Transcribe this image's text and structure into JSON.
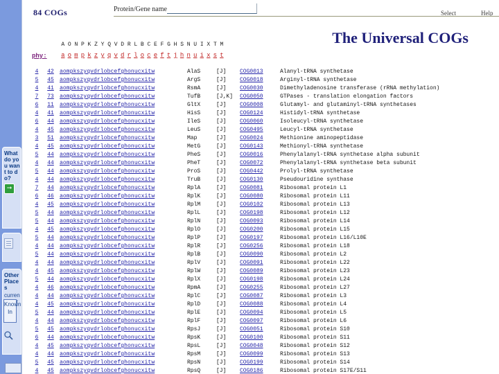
{
  "explorer_pane": {
    "card_a_title": "What do you want to do?",
    "card_a_icon": "arrow-right-icon",
    "card_b_icon": "document-icon",
    "card_c_title": "Other Places",
    "card_c_text": "current search",
    "card_c_button": "Known In",
    "search_icon": "magnifier-icon"
  },
  "toolbar": {
    "cog_count": "84 COGs",
    "search_label": "Protein/Gene name:",
    "search_value": "",
    "search_placeholder": "",
    "select_label": "Select",
    "help_label": "Help"
  },
  "title": "The Universal COGs",
  "phylogeny": {
    "label": "phy:",
    "upper": [
      "A",
      "O",
      "N",
      "P",
      "K",
      "Z",
      "Y",
      "Q",
      "V",
      "D",
      "R",
      "L",
      "B",
      "C",
      "E",
      "F",
      "G",
      "H",
      "S",
      "N",
      "U",
      "I",
      "X",
      "T",
      "M"
    ],
    "lower": [
      "a",
      "o",
      "m",
      "p",
      "k",
      "z",
      "y",
      "q",
      "v",
      "d",
      "r",
      "l",
      "o",
      "c",
      "e",
      "f",
      "t",
      "j",
      "h",
      "n",
      "u",
      "i",
      "x",
      "s",
      "t"
    ]
  },
  "table": {
    "rows": [
      {
        "n1": "4",
        "n2": "42",
        "pattern": "aompkszyqvdrlobcefghonucxitw",
        "gene": "AlaS",
        "func": "[J]",
        "cog": "COG0013",
        "desc": "Alanyl-tRNA synthetase"
      },
      {
        "n1": "5",
        "n2": "45",
        "pattern": "aompkszyqvdrlobcefghonucxitw",
        "gene": "ArgS",
        "func": "[J]",
        "cog": "COG0018",
        "desc": "Arginyl-tRNA synthetase"
      },
      {
        "n1": "4",
        "n2": "41",
        "pattern": "aompkszyqvdrlobcefghonucxitw",
        "gene": "RsmA",
        "func": "[J]",
        "cog": "COG0030",
        "desc": "Dimethyladenosine transferase (rRNA methylation)"
      },
      {
        "n1": "7",
        "n2": "73",
        "pattern": "aompkszyqvdrlobcefghonucxitw",
        "gene": "TufB",
        "func": "[J,K]",
        "cog": "COG0050",
        "desc": "GTPases - translation elongation factors"
      },
      {
        "n1": "6",
        "n2": "11",
        "pattern": "aompkszyqvdrlobcefghonucxitw",
        "gene": "GltX",
        "func": "[J]",
        "cog": "COG0008",
        "desc": "Glutamyl- and glutaminyl-tRNA synthetases"
      },
      {
        "n1": "4",
        "n2": "41",
        "pattern": "aompkszyqvdrlobcefghonucxitw",
        "gene": "HisS",
        "func": "[J]",
        "cog": "COG0124",
        "desc": "Histidyl-tRNA synthetase"
      },
      {
        "n1": "6",
        "n2": "44",
        "pattern": "aompkszyqvdrlobcefghonucxitw",
        "gene": "IleS",
        "func": "[J]",
        "cog": "COG0060",
        "desc": "Isoleucyl-tRNA synthetase"
      },
      {
        "n1": "4",
        "n2": "45",
        "pattern": "aompkszyqvdrlobcefghonucxitw",
        "gene": "LeuS",
        "func": "[J]",
        "cog": "COG0495",
        "desc": "Leucyl-tRNA synthetase"
      },
      {
        "n1": "3",
        "n2": "51",
        "pattern": "aompkszyqvdrlobcefghonucxitw",
        "gene": "Map",
        "func": "[J]",
        "cog": "COG0024",
        "desc": "Methionine aminopeptidase"
      },
      {
        "n1": "4",
        "n2": "45",
        "pattern": "aompkszyqvdrlobcefghonucxitw",
        "gene": "MetG",
        "func": "[J]",
        "cog": "COG0143",
        "desc": "Methionyl-tRNA synthetase"
      },
      {
        "n1": "5",
        "n2": "44",
        "pattern": "aompkszyqvdrlobcefghonucxitw",
        "gene": "PheS",
        "func": "[J]",
        "cog": "COG0016",
        "desc": "Phenylalanyl-tRNA synthetase alpha subunit"
      },
      {
        "n1": "4",
        "n2": "44",
        "pattern": "aompkszyqvdrlobcefghonucxitw",
        "gene": "PheT",
        "func": "[J]",
        "cog": "COG0072",
        "desc": "Phenylalanyl-tRNA synthetase beta subunit"
      },
      {
        "n1": "5",
        "n2": "44",
        "pattern": "aompkszyqvdrlobcefghonucxitw",
        "gene": "ProS",
        "func": "[J]",
        "cog": "COG0442",
        "desc": "Prolyl-tRNA synthetase"
      },
      {
        "n1": "4",
        "n2": "44",
        "pattern": "aompkszyqvdrlobcefghonucxitw",
        "gene": "TruB",
        "func": "[J]",
        "cog": "COG0130",
        "desc": "Pseudouridine synthase"
      },
      {
        "n1": "7",
        "n2": "44",
        "pattern": "aompkszyqvdrlobcefghonucxitw",
        "gene": "RplA",
        "func": "[J]",
        "cog": "COG0081",
        "desc": "Ribosomal protein L1"
      },
      {
        "n1": "6",
        "n2": "46",
        "pattern": "aompkszyqvdrlobcefghonucxitw",
        "gene": "RplK",
        "func": "[J]",
        "cog": "COG0080",
        "desc": "Ribosomal protein L11"
      },
      {
        "n1": "4",
        "n2": "45",
        "pattern": "aompkszyqvdrlobcefghonucxitw",
        "gene": "RplM",
        "func": "[J]",
        "cog": "COG0102",
        "desc": "Ribosomal protein L13"
      },
      {
        "n1": "5",
        "n2": "44",
        "pattern": "aompkszyqvdrlobcefghonucxitw",
        "gene": "RplL",
        "func": "[J]",
        "cog": "COG0198",
        "desc": "Ribosomal protein L12"
      },
      {
        "n1": "5",
        "n2": "44",
        "pattern": "aompkszyqvdrlobcefghonucxitw",
        "gene": "RplN",
        "func": "[J]",
        "cog": "COG0093",
        "desc": "Ribosomal protein L14"
      },
      {
        "n1": "4",
        "n2": "45",
        "pattern": "aompkszyqvdrlobcefghonucxitw",
        "gene": "RplO",
        "func": "[J]",
        "cog": "COG0200",
        "desc": "Ribosomal protein L15"
      },
      {
        "n1": "5",
        "n2": "44",
        "pattern": "aompkszyqvdrlobcefghonucxitw",
        "gene": "RplP",
        "func": "[J]",
        "cog": "COG0197",
        "desc": "Ribosomal protein L16/L10E"
      },
      {
        "n1": "4",
        "n2": "44",
        "pattern": "aompkszyqvdrlobcefghonucxitw",
        "gene": "RplR",
        "func": "[J]",
        "cog": "COG0256",
        "desc": "Ribosomal protein L18"
      },
      {
        "n1": "5",
        "n2": "44",
        "pattern": "aompkszyqvdrlobcefghonucxitw",
        "gene": "RplB",
        "func": "[J]",
        "cog": "COG0090",
        "desc": "Ribosomal protein L2"
      },
      {
        "n1": "4",
        "n2": "44",
        "pattern": "aompkszyqvdrlobcefghonucxitw",
        "gene": "RplV",
        "func": "[J]",
        "cog": "COG0091",
        "desc": "Ribosomal protein L22"
      },
      {
        "n1": "4",
        "n2": "45",
        "pattern": "aompkszyqvdrlobcefghonucxitw",
        "gene": "RplW",
        "func": "[J]",
        "cog": "COG0089",
        "desc": "Ribosomal protein L23"
      },
      {
        "n1": "5",
        "n2": "44",
        "pattern": "aompkszyqvdrlobcefghonucxitw",
        "gene": "RplX",
        "func": "[J]",
        "cog": "COG0198",
        "desc": "Ribosomal protein L24"
      },
      {
        "n1": "4",
        "n2": "46",
        "pattern": "aompkszyqvdrlobcefghonucxitw",
        "gene": "RpmA",
        "func": "[J]",
        "cog": "COG0255",
        "desc": "Ribosomal protein L27"
      },
      {
        "n1": "4",
        "n2": "44",
        "pattern": "aompkszyqvdrlobcefghonucxitw",
        "gene": "RplC",
        "func": "[J]",
        "cog": "COG0087",
        "desc": "Ribosomal protein L3"
      },
      {
        "n1": "4",
        "n2": "45",
        "pattern": "aompkszyqvdrlobcefghonucxitw",
        "gene": "RplD",
        "func": "[J]",
        "cog": "COG0088",
        "desc": "Ribosomal protein L4"
      },
      {
        "n1": "5",
        "n2": "44",
        "pattern": "aompkszyqvdrlobcefghonucxitw",
        "gene": "RplE",
        "func": "[J]",
        "cog": "COG0094",
        "desc": "Ribosomal protein L5"
      },
      {
        "n1": "4",
        "n2": "44",
        "pattern": "aompkszyqvdrlobcefghonucxitw",
        "gene": "RplF",
        "func": "[J]",
        "cog": "COG0097",
        "desc": "Ribosomal protein L6"
      },
      {
        "n1": "5",
        "n2": "45",
        "pattern": "aompkszyqvdrlobcefghonucxitw",
        "gene": "RpsJ",
        "func": "[J]",
        "cog": "COG0051",
        "desc": "Ribosomal protein S10"
      },
      {
        "n1": "6",
        "n2": "44",
        "pattern": "aompkszyqvdrlobcefghonucxitw",
        "gene": "RpsK",
        "func": "[J]",
        "cog": "COG0100",
        "desc": "Ribosomal protein S11"
      },
      {
        "n1": "4",
        "n2": "45",
        "pattern": "aompkszyqvdrlobcefghonucxitw",
        "gene": "RpsL",
        "func": "[J]",
        "cog": "COG0048",
        "desc": "Ribosomal protein S12"
      },
      {
        "n1": "4",
        "n2": "44",
        "pattern": "aompkszyqvdrlobcefghonucxitw",
        "gene": "RpsM",
        "func": "[J]",
        "cog": "COG0099",
        "desc": "Ribosomal protein S13"
      },
      {
        "n1": "5",
        "n2": "45",
        "pattern": "aompkszyqvdrlobcefghonucxitw",
        "gene": "RpsN",
        "func": "[J]",
        "cog": "COG0199",
        "desc": "Ribosomal protein S14"
      },
      {
        "n1": "4",
        "n2": "45",
        "pattern": "aompkszyqvdrlobcefghonucxitw",
        "gene": "RpsQ",
        "func": "[J]",
        "cog": "COG0186",
        "desc": "Ribosomal protein S17E/S11"
      }
    ]
  }
}
